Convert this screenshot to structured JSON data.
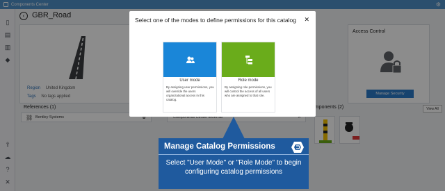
{
  "app": {
    "title": "Components Center"
  },
  "rail": {
    "icons": [
      "sticky-note-icon",
      "server-icon",
      "bar-chart-icon",
      "tags-icon",
      "upload-icon",
      "cloud-sync-icon",
      "help-icon",
      "tools-icon"
    ]
  },
  "header": {
    "title": "GBR_Road"
  },
  "details": {
    "region_label": "Region",
    "region_value": "United Kingdom",
    "tags_label": "Tags",
    "tags_value": "No tags applied"
  },
  "access_control": {
    "title": "Access Control",
    "button": "Manage Security"
  },
  "references": {
    "title": "References (1)",
    "item": "Bentley Systems"
  },
  "components_center": {
    "item": "Components Center External"
  },
  "components": {
    "title": "Components (2)",
    "view_all": "View All"
  },
  "modal": {
    "title": "Select one of the modes to define permissions for this catalog",
    "close": "✕",
    "user_mode": {
      "label": "User mode",
      "description": "By assigning user permissions, you will override the users organizational access in this catalog.",
      "color": "#1a86d8"
    },
    "role_mode": {
      "label": "Role mode",
      "description": "By assigning role permissions, you will control the access of all users who are assigned to that role.",
      "color": "#6aac1b"
    }
  },
  "callout": {
    "title": "Manage Catalog Permissions",
    "text": "Select \"User Mode\" or \"Role Mode\" to begin configuring catalog permissions",
    "color": "#1f5a9e"
  }
}
